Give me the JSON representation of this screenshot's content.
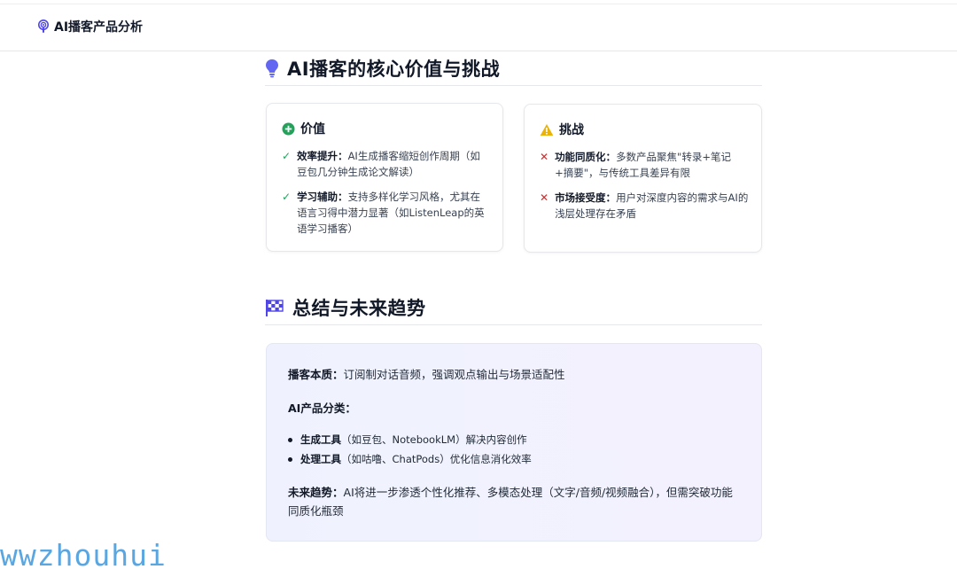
{
  "header": {
    "title": "AI播客产品分析",
    "icon": "podcast-icon"
  },
  "section1": {
    "title": "AI播客的核心价值与挑战",
    "icon": "lightbulb-icon",
    "value_card": {
      "title": "价值",
      "icon": "plus-circle-icon",
      "items": [
        {
          "term": "效率提升：",
          "text": "AI生成播客缩短创作周期（如豆包几分钟生成论文解读）"
        },
        {
          "term": "学习辅助：",
          "text": "支持多样化学习风格，尤其在语言习得中潜力显著（如ListenLeap的英语学习播客）"
        }
      ]
    },
    "challenge_card": {
      "title": "挑战",
      "icon": "warning-icon",
      "items": [
        {
          "term": "功能同质化：",
          "text": "多数产品聚焦\"转录+笔记+摘要\"，与传统工具差异有限"
        },
        {
          "term": "市场接受度：",
          "text": "用户对深度内容的需求与AI的浅层处理存在矛盾"
        }
      ]
    }
  },
  "section2": {
    "title": "总结与未来趋势",
    "icon": "checkered-flag-icon",
    "essence": {
      "term": "播客本质：",
      "text": "订阅制对话音频，强调观点输出与场景适配性"
    },
    "category_heading": "AI产品分类：",
    "categories": [
      {
        "term": "生成工具",
        "text": "（如豆包、NotebookLM）解决内容创作"
      },
      {
        "term": "处理工具",
        "text": "（如咕噜、ChatPods）优化信息消化效率"
      }
    ],
    "trend": {
      "term": "未来趋势：",
      "text": "AI将进一步渗透个性化推荐、多模态处理（文字/音频/视频融合），但需突破功能同质化瓶颈"
    }
  },
  "watermark": "wwzhouhui",
  "colors": {
    "accent": "#4f46e5",
    "check": "#22a35a",
    "cross": "#dc2626",
    "warning": "#eab308"
  }
}
